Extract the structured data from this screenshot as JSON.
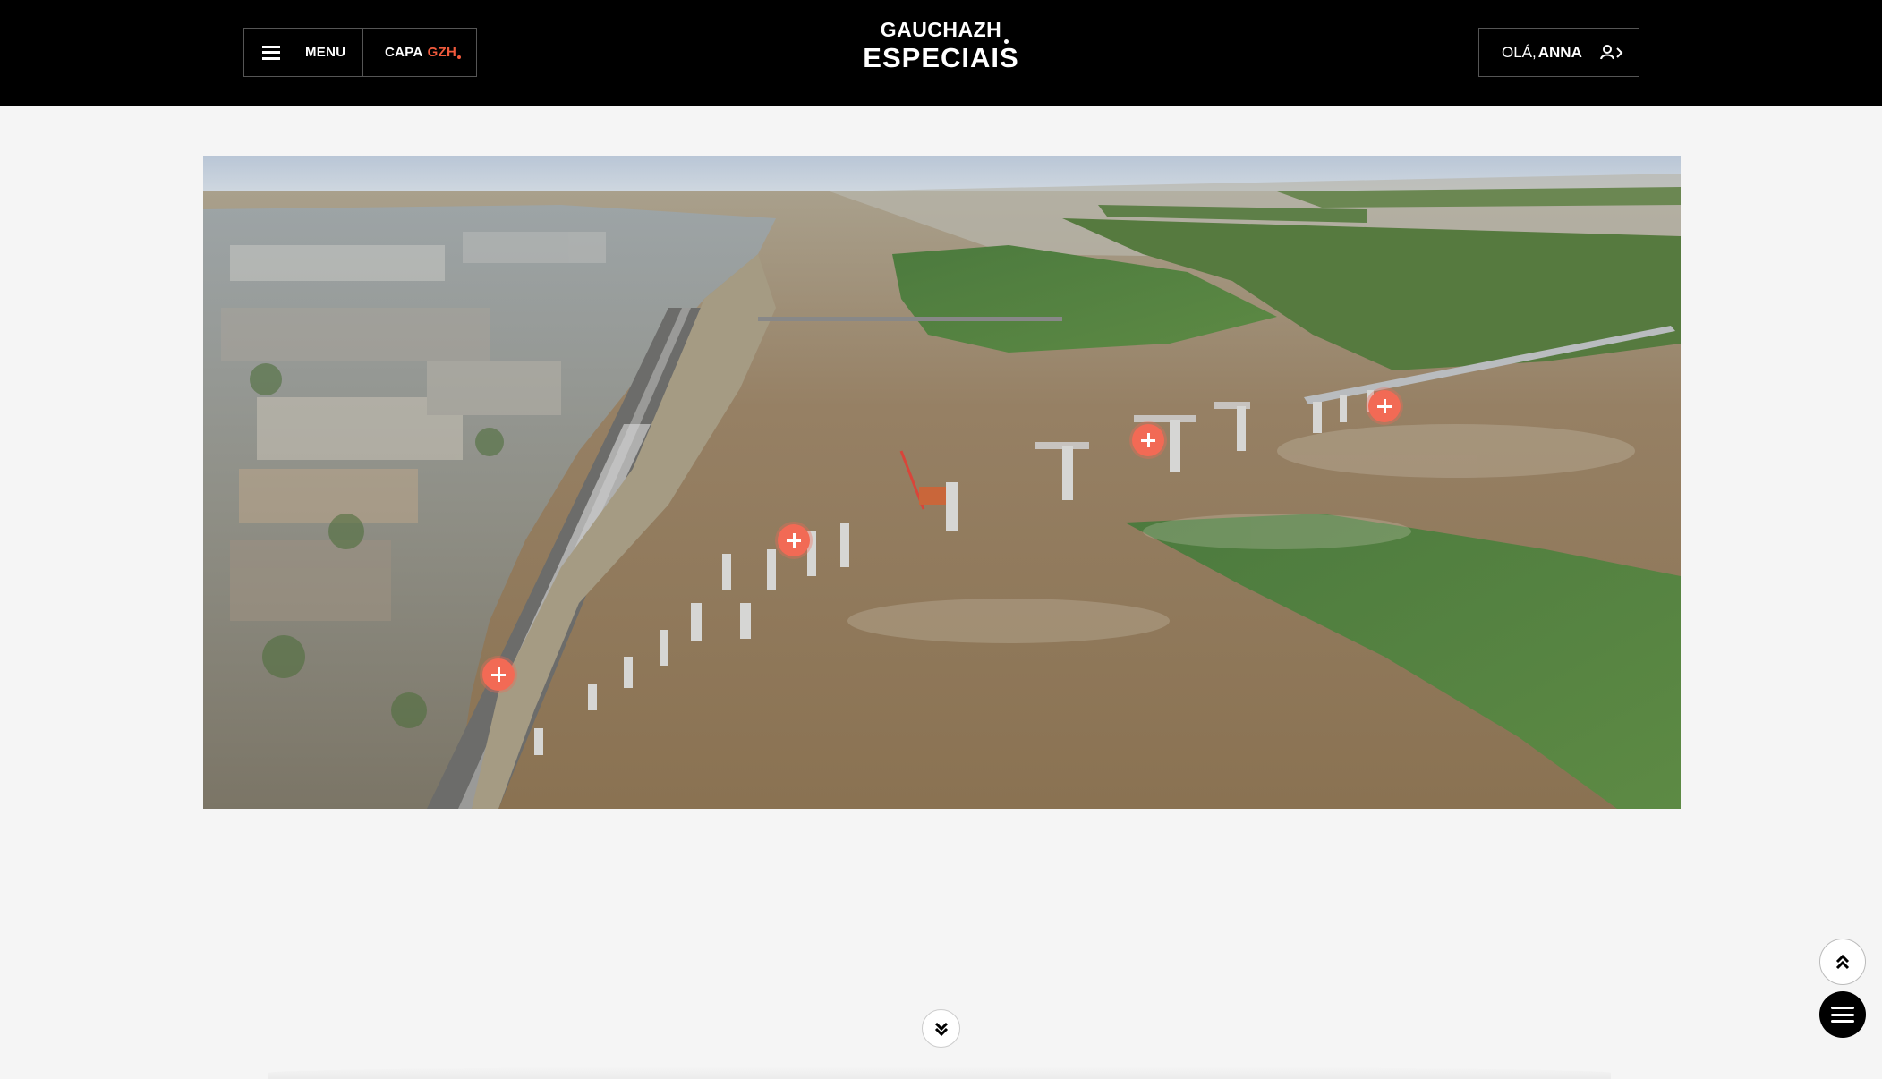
{
  "header": {
    "menu_label": "MENU",
    "capa_label": "CAPA",
    "capa_brand": "GZH",
    "brand_top": "GAUCHAZH",
    "brand_bottom": "ESPECIAIS",
    "greeting": "OLÁ,",
    "user_name": "ANNA",
    "user_icon": "user-arrow-icon"
  },
  "hero": {
    "image_subject": "aerial-bridge-construction",
    "hotspot_icon": "plus-icon",
    "hotspot_color": "#f26a55"
  },
  "controls": {
    "scroll_down_icon": "double-chevron-down-icon",
    "scroll_top_icon": "double-chevron-up-icon",
    "menu_fab_icon": "hamburger-icon"
  },
  "colors": {
    "header_bg": "#000000",
    "page_bg": "#f5f5f5",
    "accent": "#f15a3c"
  }
}
